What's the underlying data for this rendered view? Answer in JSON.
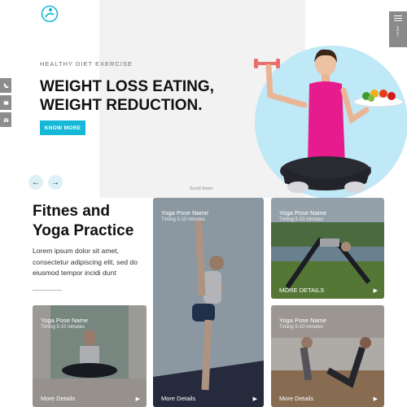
{
  "header": {
    "logo_icon": "yoga-figure-logo-icon",
    "menu_label": "MENU",
    "accent": "#15b8d6"
  },
  "social": [
    "phone-icon",
    "message-icon",
    "mail-icon"
  ],
  "hero": {
    "kicker": "HEALTHY DIET EXERCISE",
    "headline_line1": "WEIGHT LOSS EATING,",
    "headline_line2": "WEIGHT REDUCTION.",
    "button_label": "KNOW MORE",
    "prev_arrow": "←",
    "next_arrow": "→",
    "scroll_label": "Scroll down",
    "circle_color": "#bfe9f7"
  },
  "section": {
    "title_line1": "Fitnes and",
    "title_line2": "Yoga Practice",
    "body": "Lorem ipsum dolor sit amet, consectetur adipiscing elit, sed do eiusmod tempor incidi dunt"
  },
  "cards": [
    {
      "name": "Yoga Pose Name",
      "timing": "Timing 5-10 minutes",
      "more": "More Details"
    },
    {
      "name": "Yoga Pose Name",
      "timing": "Timing 5-10 minutes",
      "more": "MORE DETAILS"
    },
    {
      "name": "Yoga Pose Name",
      "timing": "Timing 5-10 minutes",
      "more": "More Details"
    },
    {
      "name": "Yoga Pose Name",
      "timing": "Timing 5-10 minutes",
      "more": "More Details"
    }
  ]
}
